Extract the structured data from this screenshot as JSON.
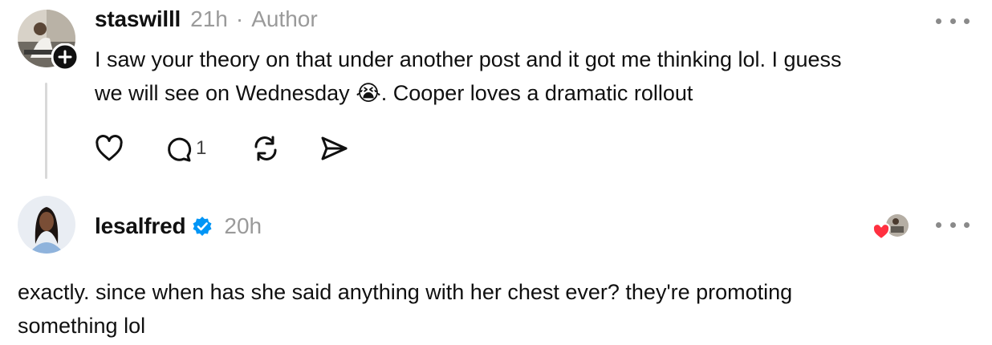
{
  "comments": [
    {
      "username": "staswilll",
      "time": "21h",
      "separator": "·",
      "tag": "Author",
      "text_line1": "I saw your theory on that under another post and it got me thinking lol. I guess",
      "text_line2_a": "we will see on Wednesday ",
      "emoji": "😭",
      "text_line2_b": ". Cooper loves a dramatic rollout",
      "reply_count": "1"
    },
    {
      "username": "lesalfred",
      "time": "20h",
      "text_line1": "exactly. since when has she said anything with her chest ever? they're promoting",
      "text_line2": "something lol"
    }
  ],
  "colors": {
    "verified": "#0095f6",
    "heart": "#ff3040",
    "muted": "#9a9a9a",
    "text": "#101010"
  },
  "icons": [
    "heart-icon",
    "comment-icon",
    "repost-icon",
    "share-icon",
    "more-icon",
    "verified-badge-icon",
    "follow-plus-icon"
  ]
}
